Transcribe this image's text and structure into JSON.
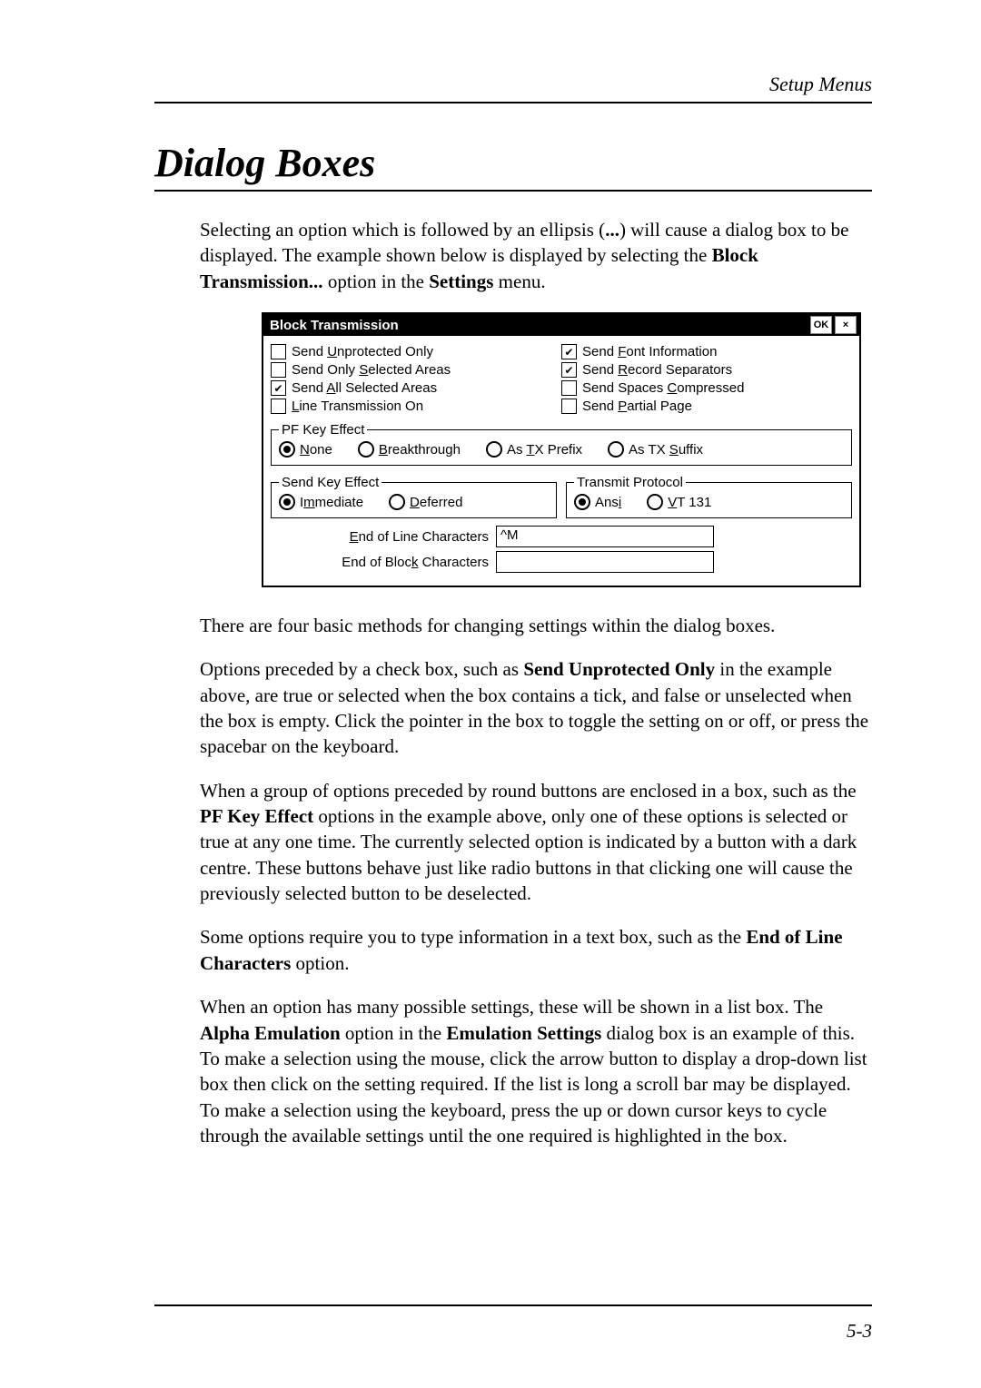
{
  "header": {
    "section": "Setup Menus"
  },
  "title": "Dialog Boxes",
  "intro": {
    "p1a": "Selecting an option which is followed by an ellipsis (",
    "p1b": "...",
    "p1c": ") will cause a dialog box to be displayed. The example shown below is displayed by selecting the ",
    "p1d": "Block Transmission...",
    "p1e": " option in the ",
    "p1f": "Settings",
    "p1g": " menu."
  },
  "dialog": {
    "title": "Block Transmission",
    "ok": "OK",
    "close": "×",
    "checks_left": [
      {
        "label_pre": "Send ",
        "u": "U",
        "label_post": "nprotected Only",
        "checked": false
      },
      {
        "label_pre": "Send Only ",
        "u": "S",
        "label_post": "elected Areas",
        "checked": false
      },
      {
        "label_pre": "Send ",
        "u": "A",
        "label_post": "ll Selected Areas",
        "checked": true
      },
      {
        "label_pre": "",
        "u": "L",
        "label_post": "ine Transmission On",
        "checked": false
      }
    ],
    "checks_right": [
      {
        "label_pre": "Send ",
        "u": "F",
        "label_post": "ont Information",
        "checked": true
      },
      {
        "label_pre": "Send ",
        "u": "R",
        "label_post": "ecord Separators",
        "checked": true
      },
      {
        "label_pre": "Send Spaces ",
        "u": "C",
        "label_post": "ompressed",
        "checked": false
      },
      {
        "label_pre": "Send ",
        "u": "P",
        "label_post": "artial Page",
        "checked": false
      }
    ],
    "pf_effect": {
      "legend": "PF Key Effect",
      "opts": [
        {
          "u": "N",
          "post": "one",
          "sel": true
        },
        {
          "u": "B",
          "post": "reakthrough",
          "sel": false
        },
        {
          "pre": "As ",
          "u": "T",
          "post": "X Prefix",
          "sel": false
        },
        {
          "pre": "As TX ",
          "u": "S",
          "post": "uffix",
          "sel": false
        }
      ]
    },
    "send_key": {
      "legend": "Send Key Effect",
      "opts": [
        {
          "pre": "I",
          "u": "m",
          "post": "mediate",
          "sel": true
        },
        {
          "u": "D",
          "post": "eferred",
          "sel": false
        }
      ]
    },
    "protocol": {
      "legend": "Transmit Protocol",
      "opts": [
        {
          "pre": "Ans",
          "u": "i",
          "post": "",
          "sel": true
        },
        {
          "u": "V",
          "post": "T 131",
          "sel": false
        }
      ]
    },
    "eol": {
      "label_u": "E",
      "label_post": "nd of Line Characters",
      "value": "^M"
    },
    "eob": {
      "label_pre": "End of Bloc",
      "label_u": "k",
      "label_post": " Characters",
      "value": ""
    }
  },
  "para2": "There are four basic methods for changing settings within the dialog boxes.",
  "para3a": "Options preceded by a check box, such as ",
  "para3b": "Send Unprotected Only",
  "para3c": " in the example above, are true or selected when the box contains a tick, and false or unselected when the box is empty. Click the pointer in the box to toggle the setting on or off, or press the spacebar on the keyboard.",
  "para4a": "When a group of options preceded by round buttons are enclosed in a box, such as the ",
  "para4b": "PF Key Effect",
  "para4c": " options in the example above, only one of these options is selected or true at any one time. The currently selected option is indicated by a button with a dark centre. These buttons behave just like radio buttons in that clicking one will cause the previously selected button to be deselected.",
  "para5a": "Some options require you to type information in a text box, such as the ",
  "para5b": "End of Line Characters",
  "para5c": " option.",
  "para6a": "When an option has many possible settings, these will be shown in a list box. The ",
  "para6b": "Alpha Emulation",
  "para6c": " option in the ",
  "para6d": "Emulation Settings",
  "para6e": " dialog box is an example of this. To make a selection using the mouse, click the arrow button to display a drop-down list box then click on the setting required. If the list is long a scroll bar may be displayed. To make a selection using the keyboard, press the up or down cursor keys to cycle through the available settings until the one required is highlighted in the box.",
  "page_number": "5-3"
}
